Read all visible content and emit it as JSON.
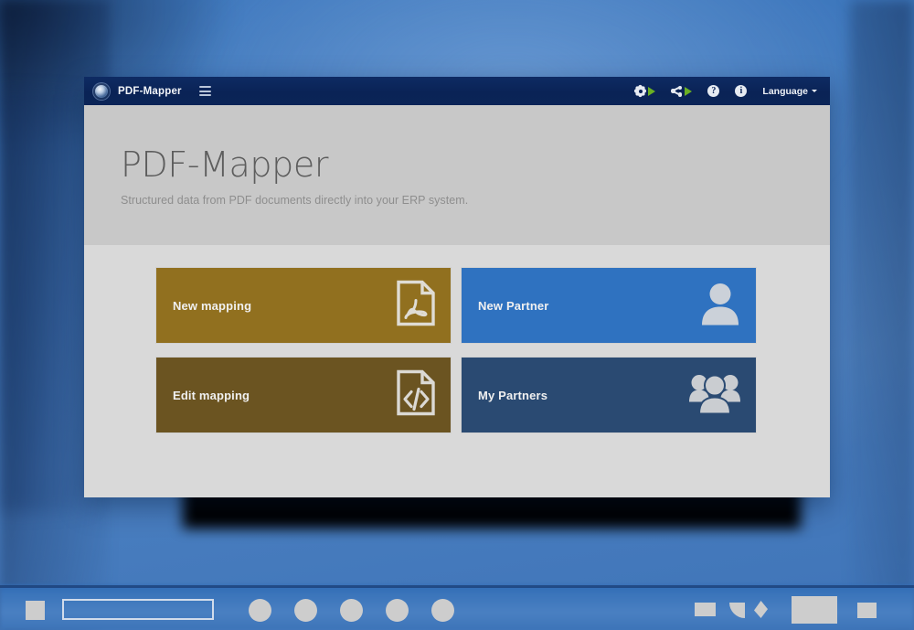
{
  "window": {
    "navbar": {
      "brand_label": "PDF-Mapper",
      "logo_icon": "sphere-logo-icon",
      "menu_icon": "hamburger-menu-icon",
      "actions": [
        {
          "name": "settings-run",
          "icon": "gear-play-icon"
        },
        {
          "name": "workflow-run",
          "icon": "share-play-icon"
        },
        {
          "name": "help",
          "icon": "question-circle-icon",
          "glyph": "?"
        },
        {
          "name": "info",
          "icon": "info-circle-icon",
          "glyph": "i"
        }
      ],
      "language_label": "Language",
      "language_caret_icon": "caret-down-icon"
    },
    "hero": {
      "title": "PDF-Mapper",
      "subtitle": "Structured data from PDF documents directly into your ERP system."
    },
    "tiles": [
      {
        "label": "New mapping",
        "icon": "pdf-file-icon",
        "color": "#91701f"
      },
      {
        "label": "New Partner",
        "icon": "user-icon",
        "color": "#2f72c0"
      },
      {
        "label": "Edit mapping",
        "icon": "code-file-icon",
        "color": "#6b5421"
      },
      {
        "label": "My Partners",
        "icon": "users-group-icon",
        "color": "#2a4a72"
      }
    ]
  },
  "taskbar": {
    "items": [
      {
        "name": "start-button",
        "icon": "square-icon"
      },
      {
        "name": "search-field",
        "icon": "search-box-outline"
      },
      {
        "name": "task-icon-1",
        "icon": "circle-icon"
      },
      {
        "name": "task-icon-2",
        "icon": "circle-icon"
      },
      {
        "name": "task-icon-3",
        "icon": "circle-icon"
      },
      {
        "name": "task-icon-4",
        "icon": "circle-icon"
      },
      {
        "name": "task-icon-5",
        "icon": "circle-icon"
      },
      {
        "name": "tray-icon-1",
        "icon": "rect-icon"
      },
      {
        "name": "tray-network",
        "icon": "wifi-icon"
      },
      {
        "name": "tray-volume",
        "icon": "speaker-icon"
      },
      {
        "name": "tray-clock",
        "icon": "clock-block"
      },
      {
        "name": "show-desktop",
        "icon": "rect-icon"
      }
    ]
  },
  "theme": {
    "navbar_bg": "#0a2356",
    "hero_bg": "#c8c8c8",
    "body_bg": "#d9d9d9",
    "accent_green": "#6ab023",
    "desktop_blue": "#4179bd"
  }
}
